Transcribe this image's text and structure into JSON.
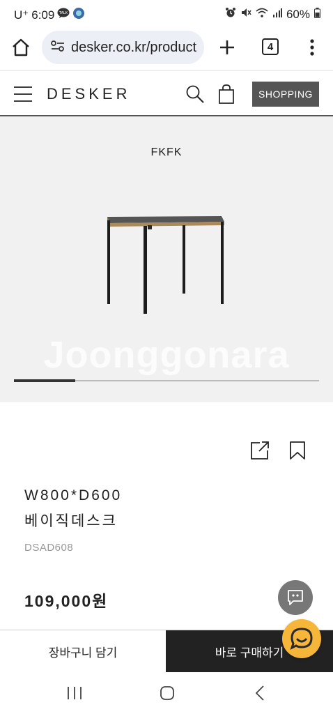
{
  "status": {
    "carrier": "U⁺",
    "time": "6:09",
    "battery": "60%"
  },
  "browser": {
    "url": "desker.co.kr/product",
    "tab_count": "4",
    "icons": [
      "home-icon",
      "site-settings-icon",
      "new-tab-icon",
      "tab-switcher-icon",
      "more-icon"
    ]
  },
  "header": {
    "logo": "DESKER",
    "shopping_label": "SHOPPING",
    "icons": [
      "menu-icon",
      "search-icon",
      "cart-icon"
    ]
  },
  "gallery": {
    "label": "FKFK",
    "watermark": "Joonggonara",
    "progress_fraction": 0.2
  },
  "product": {
    "title_line1": "W800*D600",
    "title_line2": "베이직데스크",
    "sku": "DSAD608",
    "price": "109,000원",
    "icons": [
      "share-icon",
      "bookmark-icon"
    ]
  },
  "actions": {
    "cart_label": "장바구니 담기",
    "buy_label": "바로 구매하기"
  },
  "colors": {
    "accent_dark": "#222222",
    "shopping_bg": "#555555",
    "help_fab": "#f6b63a",
    "gallery_bg": "#f1f1f1"
  }
}
